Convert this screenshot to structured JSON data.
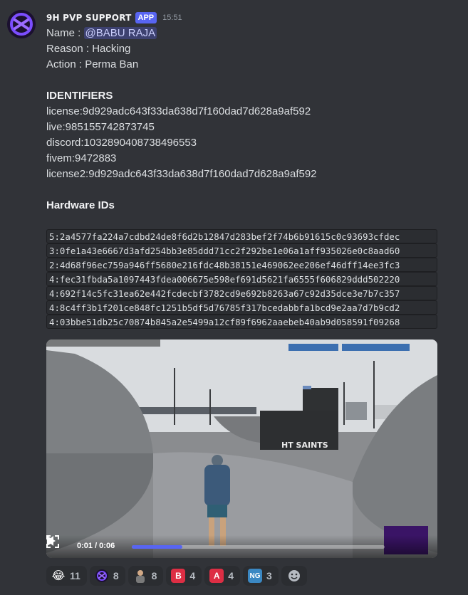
{
  "message": {
    "author": "9H PVP SUPPORT",
    "app_badge": "APP",
    "timestamp": "15:51",
    "name_label": "Name : ",
    "mention": "@BABU RAJA",
    "reason": "Reason : Hacking",
    "action": "Action : Perma Ban",
    "identifiers_heading": "IDENTIFIERS",
    "identifiers": [
      "license:9d929adc643f33da638d7f160dad7d628a9af592",
      "live:985155742873745",
      "discord:1032890408738496553",
      "fivem:9472883",
      "license2:9d929adc643f33da638d7f160dad7d628a9af592"
    ],
    "hardware_heading": "Hardware IDs",
    "hardware_ids": [
      "5:2a4577fa224a7cdbd24de8f6d2b12847d283bef2f74b6b91615c0c93693cfdec",
      "3:0fe1a43e6667d3afd254bb3e85ddd71cc2f292be1e06a1aff935026e0c8aad60",
      "2:4d68f96ec759a946ff5680e216fdc48b38151e469062ee206ef46dff14ee3fc3",
      "4:fec31fbda5a1097443fdea006675e598ef691d5621fa6555f606829ddd502220",
      "4:692f14c5fc31ea62e442fcdecbf3782cd9e692b8263a67c92d35dce3e7b7c357",
      "4:8c4ff3b1f201ce848fc1251b5df5d76785f317bcedabbfa1bcd9e2aa7d7b9cd2",
      "4:03bbe51db25c70874b845a2e5499a12cf89f6962aaebeb40ab9d058591f09268"
    ]
  },
  "video": {
    "time": "0:01 / 0:06",
    "progress": 0.2,
    "scene_text": "HT SAINTS"
  },
  "reactions": [
    {
      "emoji": "😂",
      "count": "11",
      "color": "#f5b83d"
    },
    {
      "emoji": "server",
      "count": "8",
      "color": "#3b1d6e"
    },
    {
      "emoji": "person",
      "count": "8",
      "color": "#6b6b6b"
    },
    {
      "emoji": "B",
      "count": "4",
      "color": "#dd2e44"
    },
    {
      "emoji": "A",
      "count": "4",
      "color": "#dd2e44"
    },
    {
      "emoji": "NG",
      "count": "3",
      "color": "#3b88c3"
    }
  ],
  "colors": {
    "background": "#313338",
    "accent": "#5865f2",
    "mention_bg": "rgba(88,101,242,0.3)"
  }
}
